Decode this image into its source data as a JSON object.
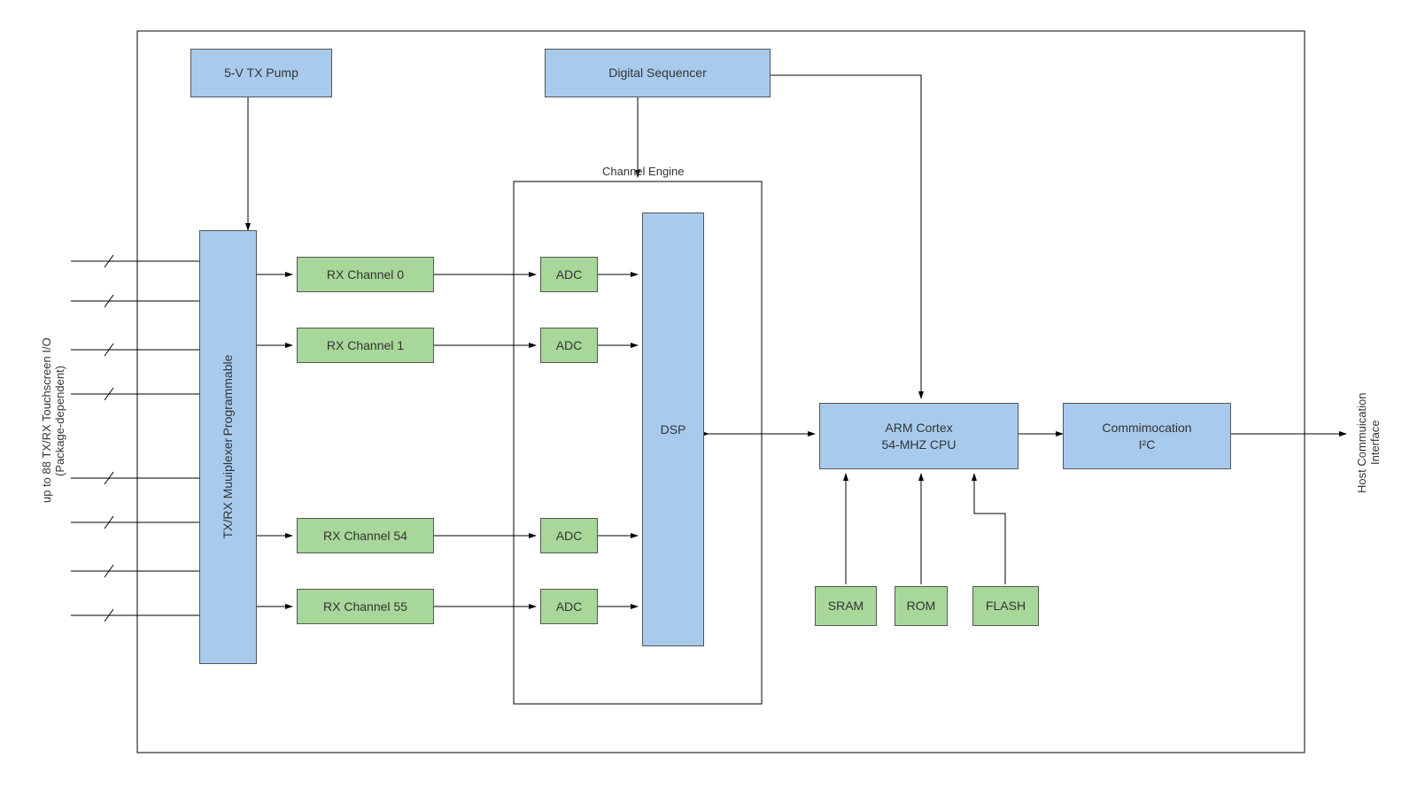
{
  "leftLabel": "up to 88 TX/RX Touchscreen I/O\n(Package-dependent)",
  "rightLabel": "Host Commuication\nInterface",
  "txPump": "5-V TX Pump",
  "sequencer": "Digital Sequencer",
  "channelEngineTitle": "Channel Engine",
  "muxLine1": "Programmable",
  "muxLine2": "TX/RX Muuiplexer",
  "rx0": "RX Channel 0",
  "rx1": "RX Channel 1",
  "rx54": "RX Channel 54",
  "rx55": "RX Channel 55",
  "adc": "ADC",
  "dsp": "DSP",
  "cpuLine1": "ARM Cortex",
  "cpuLine2": "54-MHZ CPU",
  "comm": "Commimocation\nI²C",
  "sram": "SRAM",
  "rom": "ROM",
  "flash": "FLASH"
}
